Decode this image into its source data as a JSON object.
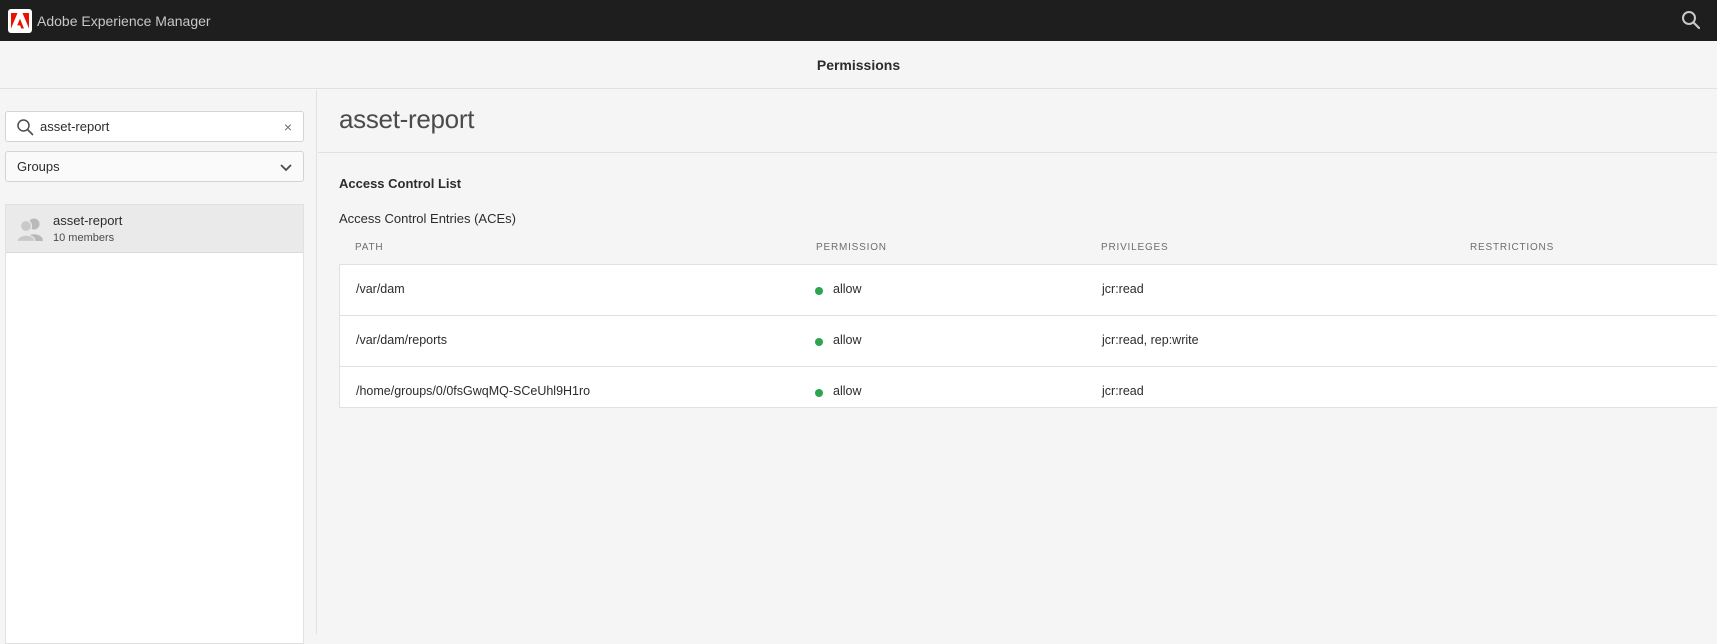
{
  "app": {
    "title": "Adobe Experience Manager",
    "logo_icon": "adobe-logo-icon"
  },
  "header": {
    "title": "Permissions"
  },
  "sidebar": {
    "search": {
      "value": "asset-report",
      "placeholder": "Search"
    },
    "clear_label": "×",
    "filter": {
      "selected": "Groups"
    },
    "items": [
      {
        "name": "asset-report",
        "members": "10 members",
        "icon": "group-avatar-icon"
      }
    ]
  },
  "main": {
    "group_title": "asset-report",
    "acl_heading": "Access Control List",
    "ace_heading": "Access Control Entries (ACEs)",
    "columns": {
      "path": "PATH",
      "permission": "PERMISSION",
      "privileges": "PRIVILEGES",
      "restrictions": "RESTRICTIONS"
    },
    "rows": [
      {
        "path": "/var/dam",
        "permission": "allow",
        "privileges": "jcr:read",
        "restrictions": ""
      },
      {
        "path": "/var/dam/reports",
        "permission": "allow",
        "privileges": "jcr:read, rep:write",
        "restrictions": ""
      },
      {
        "path": "/home/groups/0/0fsGwqMQ-SCeUhl9H1ro",
        "permission": "allow",
        "privileges": "jcr:read",
        "restrictions": ""
      }
    ]
  },
  "colors": {
    "topbar": "#1e1e1e",
    "allow_status": "#2da44e",
    "brand_red": "#eb1000"
  }
}
